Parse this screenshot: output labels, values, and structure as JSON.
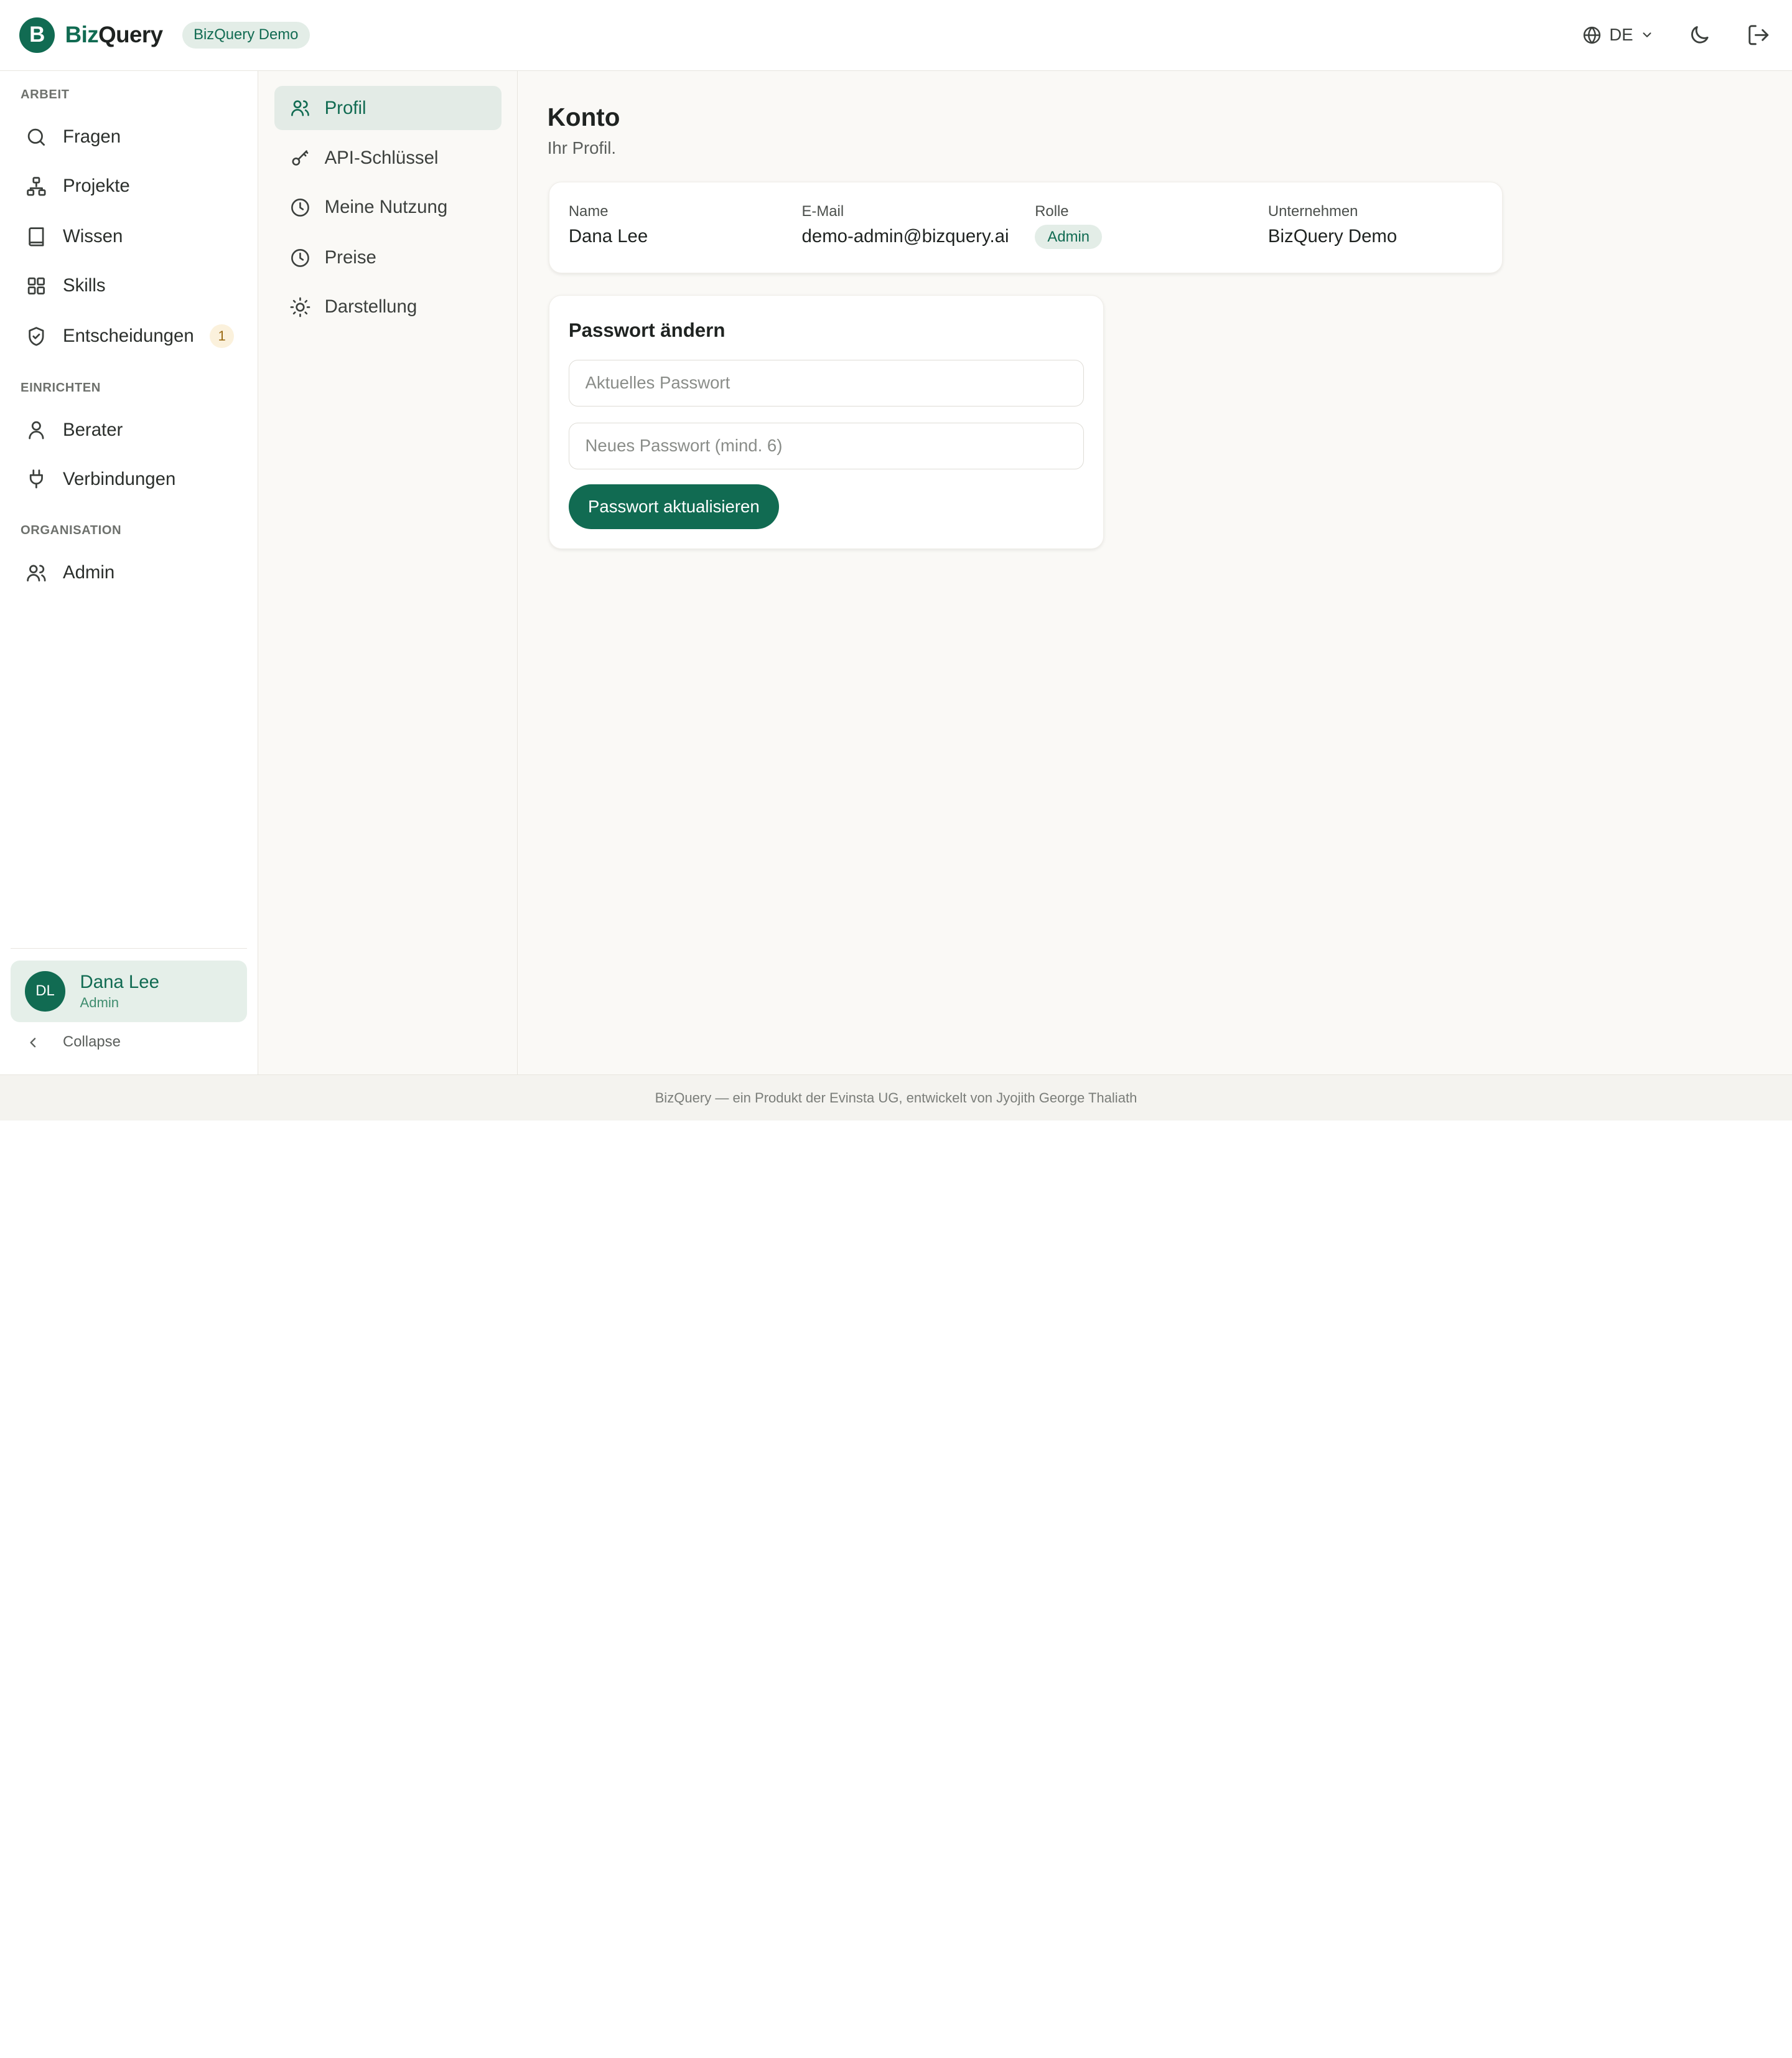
{
  "header": {
    "logo_letter": "B",
    "brand_part1": "Biz",
    "brand_part2": "Query",
    "org_label": "BizQuery Demo",
    "language": "DE"
  },
  "sidebar": {
    "sections": {
      "work": "ARBEIT",
      "setup": "EINRICHTEN",
      "organisation": "ORGANISATION"
    },
    "items": {
      "questions": "Fragen",
      "projects": "Projekte",
      "knowledge": "Wissen",
      "skills": "Skills",
      "decisions": "Entscheidungen",
      "decisions_count": "1",
      "advisors": "Berater",
      "connections": "Verbindungen",
      "admin": "Admin"
    },
    "user": {
      "initials": "DL",
      "name": "Dana Lee",
      "role": "Admin"
    },
    "collapse_label": "Collapse"
  },
  "subnav": {
    "profile": "Profil",
    "api_keys": "API-Schlüssel",
    "usage": "Meine Nutzung",
    "pricing": "Preise",
    "appearance": "Darstellung"
  },
  "main": {
    "title": "Konto",
    "subtitle": "Ihr Profil.",
    "profile": {
      "name_label": "Name",
      "name_value": "Dana Lee",
      "email_label": "E-Mail",
      "email_value": "demo-admin@bizquery.ai",
      "role_label": "Rolle",
      "role_value": "Admin",
      "company_label": "Unternehmen",
      "company_value": "BizQuery Demo"
    },
    "password": {
      "title": "Passwort ändern",
      "current_placeholder": "Aktuelles Passwort",
      "new_placeholder": "Neues Passwort (mind. 6)",
      "submit_label": "Passwort aktualisieren"
    }
  },
  "footer": {
    "text": "BizQuery — ein Produkt der Evinsta UG, entwickelt von Jyojith George Thaliath"
  },
  "colors": {
    "accent": "#116b52",
    "accent_soft": "#e3ede7",
    "badge_bg": "#fbf1dc",
    "background": "#faf9f6"
  }
}
